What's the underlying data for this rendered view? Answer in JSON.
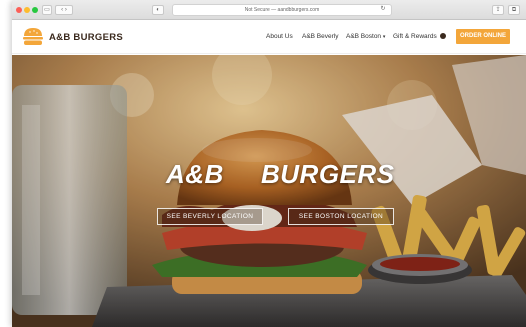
{
  "browser": {
    "address_text": "Not Secure — aandbburgers.com"
  },
  "brand": {
    "name": "A&B BURGERS"
  },
  "nav": {
    "items": [
      {
        "label": "About Us"
      },
      {
        "label": "A&B Beverly"
      },
      {
        "label": "A&B Boston"
      },
      {
        "label": "Gift & Rewards"
      }
    ],
    "order_button": "ORDER ONLINE"
  },
  "hero": {
    "title_left": "A&B",
    "title_right": "BURGERS",
    "buttons": [
      {
        "label": "SEE BEVERLY LOCATION"
      },
      {
        "label": "SEE BOSTON LOCATION"
      }
    ]
  },
  "colors": {
    "accent": "#f3a63a",
    "brand_text": "#3b2a1e"
  }
}
